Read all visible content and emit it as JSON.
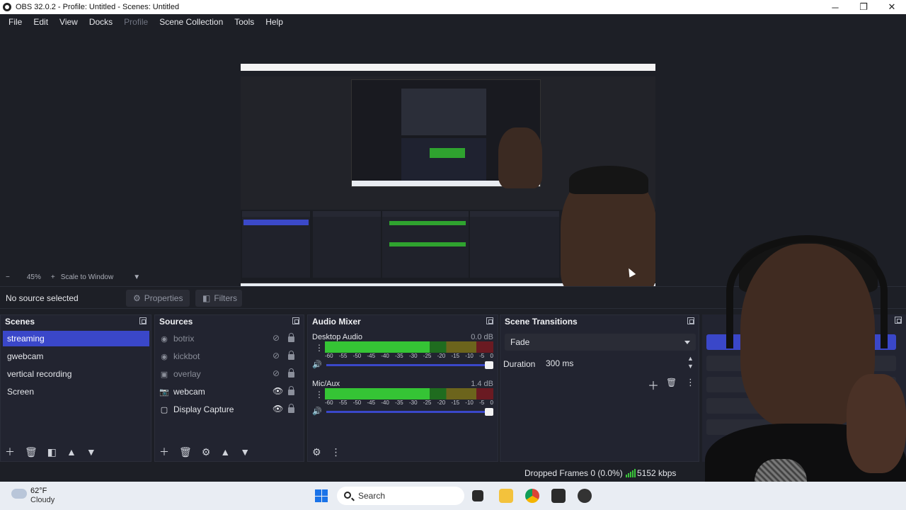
{
  "window": {
    "title": "OBS 32.0.2 - Profile: Untitled - Scenes: Untitled"
  },
  "menu": [
    "File",
    "Edit",
    "View",
    "Docks",
    "Profile",
    "Scene Collection",
    "Tools",
    "Help"
  ],
  "preview": {
    "zoom_minus": "−",
    "zoom": "45%",
    "zoom_plus": "+",
    "scale_mode": "Scale to Window"
  },
  "context": {
    "no_source": "No source selected",
    "properties": "Properties",
    "filters": "Filters"
  },
  "scenes": {
    "title": "Scenes",
    "items": [
      "streaming",
      "gwebcam",
      "vertical recording",
      "Screen"
    ],
    "selected": "streaming"
  },
  "sources": {
    "title": "Sources",
    "items": [
      {
        "name": "botrix",
        "visible": false
      },
      {
        "name": "kickbot",
        "visible": false
      },
      {
        "name": "overlay",
        "visible": false
      },
      {
        "name": "webcam",
        "visible": true
      },
      {
        "name": "Display Capture",
        "visible": true
      }
    ]
  },
  "mixer": {
    "title": "Audio Mixer",
    "channels": [
      {
        "name": "Desktop Audio",
        "db": "0.0 dB",
        "level": 0.62
      },
      {
        "name": "Mic/Aux",
        "db": "1.4 dB",
        "level": 0.62
      }
    ],
    "ticks": [
      "-60",
      "-55",
      "-50",
      "-45",
      "-40",
      "-35",
      "-30",
      "-25",
      "-20",
      "-15",
      "-10",
      "-5",
      "0"
    ]
  },
  "transitions": {
    "title": "Scene Transitions",
    "selected": "Fade",
    "duration_label": "Duration",
    "duration_value": "300 ms"
  },
  "status": {
    "dropped": "Dropped Frames 0 (0.0%)",
    "kbps": "5152 kbps"
  },
  "taskbar": {
    "temp": "62°F",
    "weather": "Cloudy",
    "search": "Search"
  },
  "colors": {
    "accent": "#3a47c9",
    "meter_green": "#35c435"
  }
}
